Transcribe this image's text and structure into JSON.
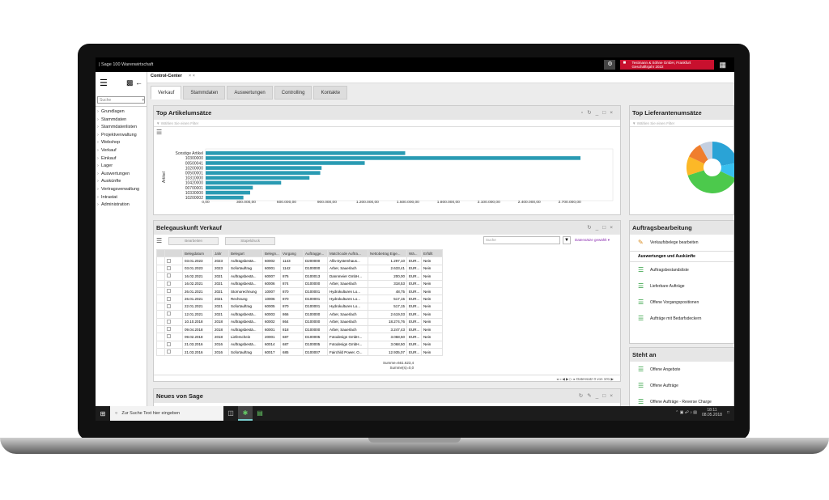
{
  "window_title": "| Sage 100 Warenwirtschaft",
  "company": {
    "name": "Testmann & Söhne GmbH, Frankfurt",
    "fiscal": "Geschäftsjahr 2022"
  },
  "sidebar": {
    "search_placeholder": "Suche",
    "items": [
      "Grundlagen",
      "Stammdaten",
      "Stammdatenlisten",
      "Projektverwaltung",
      "Webshop",
      "Verkauf",
      "Einkauf",
      "Lager",
      "Auswertungen",
      "Auskünfte",
      "Vertragsverwaltung",
      "Intrastat",
      "Administration"
    ]
  },
  "center_tab": {
    "label": "Control-Center",
    "close": "× ×"
  },
  "tabs": [
    "Verkauf",
    "Stammdaten",
    "Auswertungen",
    "Controlling",
    "Kontakte"
  ],
  "top_articles": {
    "title": "Top Artikelumsätze",
    "filter": "Wählen Sie einen Filter"
  },
  "top_suppliers": {
    "title": "Top Lieferantenumsätze",
    "filter": "Wählen Sie einen Filter"
  },
  "chart_data": {
    "type": "bar",
    "orientation": "horizontal",
    "categories": [
      "Sonstige Artikel",
      "10300000",
      "00500041",
      "10200000",
      "00500001",
      "10310000",
      "10420000",
      "00700001",
      "10330000",
      "10200002"
    ],
    "values": [
      1480000,
      2780000,
      1180000,
      860000,
      850000,
      770000,
      560000,
      350000,
      330000,
      280000
    ],
    "ylabel": "Artikel",
    "xlim": [
      0,
      2900000
    ],
    "ticks": [
      "0,00",
      "300.000,00",
      "600.000,00",
      "900.000,00",
      "1.200.000,00",
      "1.500.000,00",
      "1.800.000,00",
      "2.100.000,00",
      "2.400.000,00",
      "2.700.000,00"
    ],
    "bar_color": "#2a9bb3"
  },
  "pie": {
    "colors": [
      "#2aa3d6",
      "#38c0ef",
      "#4cc94c",
      "#fcb827",
      "#f07e2d",
      "#c4cfe0"
    ],
    "values": [
      22,
      10,
      38,
      12,
      10,
      8
    ]
  },
  "beleg": {
    "title": "Belegauskunft Verkauf",
    "btn1": "Bearbeiten",
    "btn2": "Stapeldruck",
    "search": "Suche",
    "selection": "Datensätze gewählt",
    "headers": [
      "",
      "",
      "Belegdatum",
      "Jahr",
      "Belegart",
      "Belegn...",
      "Vorgang",
      "Auftragge...",
      "Matchcode Auftra...",
      "Nettobetrag Eige...",
      "Wä...",
      "Erfüllt"
    ],
    "rows": [
      [
        "03.01.2023",
        "2023",
        "Auftragsbestä...",
        "60002",
        "1143",
        "D200000",
        "Alfa-Systemhaus...",
        "1.297,10",
        "EUR...",
        "Nein"
      ],
      [
        "03.01.2023",
        "2023",
        "Sofortauftrag",
        "60001",
        "1142",
        "D100000",
        "Arber, Sauerlach",
        "2.633,41",
        "EUR...",
        "Nein"
      ],
      [
        "16.02.2021",
        "2021",
        "Auftragsbestä...",
        "60007",
        "875",
        "D100013",
        "Dannmeier GmbH...",
        "200,00",
        "EUR...",
        "Nein"
      ],
      [
        "16.02.2021",
        "2021",
        "Auftragsbestä...",
        "60006",
        "874",
        "D100000",
        "Arber, Sauerlach",
        "318,53",
        "EUR...",
        "Nein"
      ],
      [
        "26.01.2021",
        "2021",
        "Stornorechnung",
        "10007",
        "870",
        "D100001",
        "Hydrokulturen Lo...",
        "48,75",
        "EUR...",
        "Nein"
      ],
      [
        "26.01.2021",
        "2021",
        "Rechnung",
        "10006",
        "870",
        "D100001",
        "Hydrokulturen Lo...",
        "517,15",
        "EUR...",
        "Nein"
      ],
      [
        "22.01.2021",
        "2021",
        "Sofortauftrag",
        "60005",
        "870",
        "D100001",
        "Hydrokulturen Lo...",
        "517,15",
        "EUR...",
        "Nein"
      ],
      [
        "12.01.2021",
        "2021",
        "Auftragsbestä...",
        "60003",
        "866",
        "D100000",
        "Arber, Sauerlach",
        "2.619,03",
        "EUR...",
        "Nein"
      ],
      [
        "10.10.2018",
        "2018",
        "Auftragsbestä...",
        "60002",
        "864",
        "D100000",
        "Arber, Sauerlach",
        "18.274,76",
        "EUR...",
        "Nein"
      ],
      [
        "09.04.2018",
        "2018",
        "Auftragsbestä...",
        "60001",
        "818",
        "D100000",
        "Arber, Sauerlach",
        "3.247,43",
        "EUR...",
        "Nein"
      ],
      [
        "09.02.2018",
        "2018",
        "Lieferschein",
        "20001",
        "687",
        "D100005",
        "Fotodesign GmbH...",
        "3.068,50",
        "EUR...",
        "Nein"
      ],
      [
        "21.03.2016",
        "2016",
        "Auftragsbestä...",
        "60014",
        "687",
        "D100005",
        "Fotodesign GmbH...",
        "3.068,50",
        "EUR...",
        "Nein"
      ],
      [
        "21.03.2016",
        "2016",
        "Sofortauftrag",
        "60017",
        "685",
        "D100007",
        "Fairchild Power, O...",
        "12.935,07",
        "EUR...",
        "Nein"
      ]
    ],
    "sum1": "Summe=661.623,4",
    "sum2": "Summe(s)=0,0",
    "pager": "Datensatz 0 von 101"
  },
  "news": {
    "title": "Neues von Sage"
  },
  "auftrag": {
    "title": "Auftragsbearbeitung",
    "item0": "Verkaufsbelege bearbeiten",
    "section": "Auswertungen und Auskünfte",
    "items": [
      "Auftragsbestandsliste",
      "Lieferbare Aufträge",
      "Offene Vorgangspositionen",
      "Aufträge mit Bedarfsdeckern"
    ]
  },
  "steht": {
    "title": "Steht an",
    "items": [
      "Offene Angebote",
      "Offene Aufträge",
      "Offene Aufträge - Reverse Charge"
    ]
  },
  "taskbar": {
    "search": "Zur Suche Text hier eingeben",
    "time": "18:11",
    "date": "08.05.2018"
  }
}
